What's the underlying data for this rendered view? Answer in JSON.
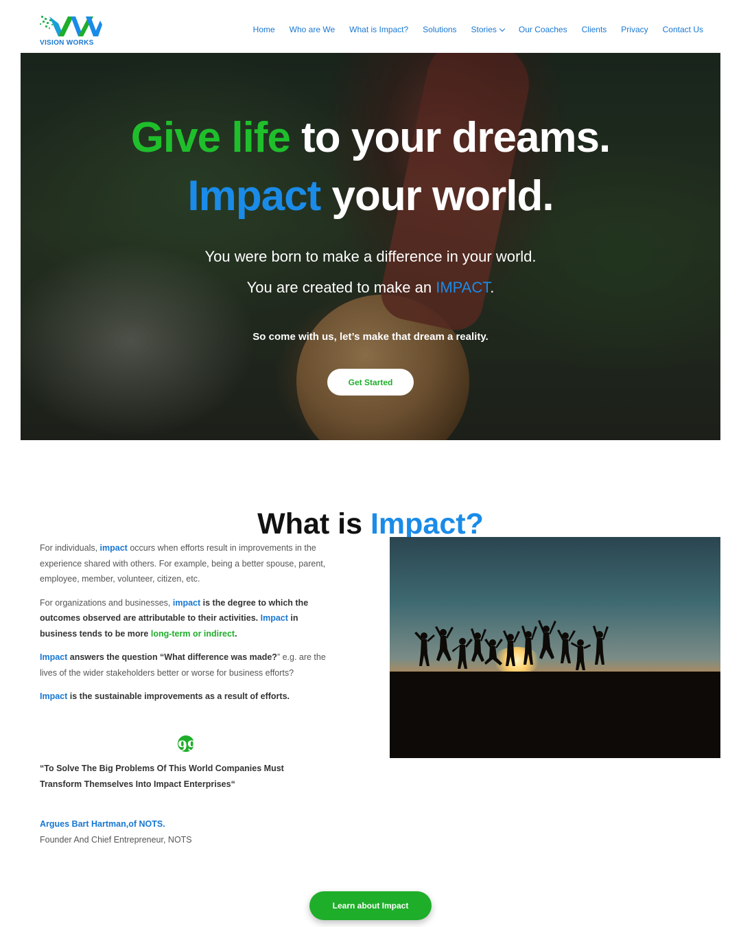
{
  "brand": {
    "logo_text": "VISION WORKS"
  },
  "nav": {
    "items": [
      {
        "label": "Home"
      },
      {
        "label": "Who are We"
      },
      {
        "label": "What is Impact?"
      },
      {
        "label": "Solutions"
      },
      {
        "label": "Stories"
      },
      {
        "label": "Our Coaches"
      },
      {
        "label": "Clients"
      },
      {
        "label": "Privacy"
      },
      {
        "label": "Contact Us"
      }
    ]
  },
  "hero": {
    "line1_accent": "Give life",
    "line1_rest": " to your dreams.",
    "line2_accent": "Impact",
    "line2_rest": " your world.",
    "sub1": "You were born to make a difference in your world.",
    "sub2_pre": "You are created to make an ",
    "sub2_accent": "IMPACT",
    "sub2_post": ".",
    "cta_text": "So come with us, let’s make that dream a reality.",
    "button": "Get Started"
  },
  "section": {
    "title_pre": "What is ",
    "title_accent": "Impact?",
    "p1": {
      "a": "For individuals, ",
      "k": "impact",
      "b": " occurs when efforts result in improvements in the experience shared with others.  For example, being a better spouse, parent, employee, member, volunteer, citizen, etc."
    },
    "p2": {
      "a": "For organizations and businesses, ",
      "k1": "impact",
      "b": " is the degree to which the outcomes observed are attributable to their activities. ",
      "k2": "Impact",
      "c": " in business tends to be more ",
      "k3": "long-term or indirect",
      "d": "."
    },
    "p3": {
      "k": "Impact",
      "b": " answers the question “What difference was made?",
      "c": "” e.g. are the lives of the wider stakeholders better or worse for business efforts?"
    },
    "p4": {
      "k": "Impact",
      "b": " is the sustainable improvements as a result of efforts."
    },
    "quote_mark": "99",
    "quote": "“To Solve The Big Problems Of This World Companies Must Transform Themselves Into Impact Enterprises“",
    "author": "Argues Bart Hartman,of NOTS.",
    "author_role": "Founder And Chief Entrepreneur, NOTS",
    "button": "Learn about Impact"
  },
  "colors": {
    "accent_green": "#1fae2a",
    "accent_blue": "#1a8be8",
    "nav_blue": "#1877d2"
  },
  "icons": {
    "dropdown": "chevron-down-icon",
    "quote": "quote-icon"
  }
}
